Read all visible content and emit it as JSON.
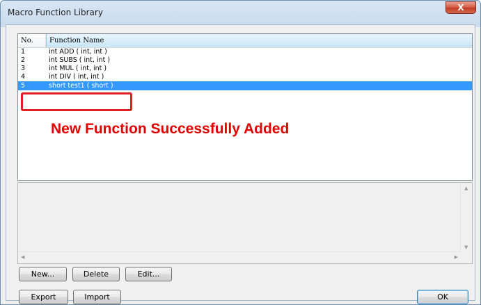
{
  "window": {
    "title": "Macro Function Library",
    "close_glyph": "X"
  },
  "list": {
    "columns": {
      "no": "No.",
      "name": "Function Name"
    },
    "rows": [
      {
        "no": "1",
        "name": "int ADD ( int, int )"
      },
      {
        "no": "2",
        "name": "int SUBS ( int, int )"
      },
      {
        "no": "3",
        "name": "int MUL ( int, int )"
      },
      {
        "no": "4",
        "name": "int DIV ( int, int )"
      },
      {
        "no": "5",
        "name": "short test1 ( short )"
      }
    ],
    "selected_index": 4
  },
  "annotation": {
    "text": "New Function Successfully Added",
    "color": "#e00000"
  },
  "buttons": {
    "new": "New...",
    "delete": "Delete",
    "edit": "Edit...",
    "export": "Export",
    "import": "Import",
    "ok": "OK"
  },
  "colors": {
    "selection": "#3399ff",
    "callout": "#e02020"
  }
}
